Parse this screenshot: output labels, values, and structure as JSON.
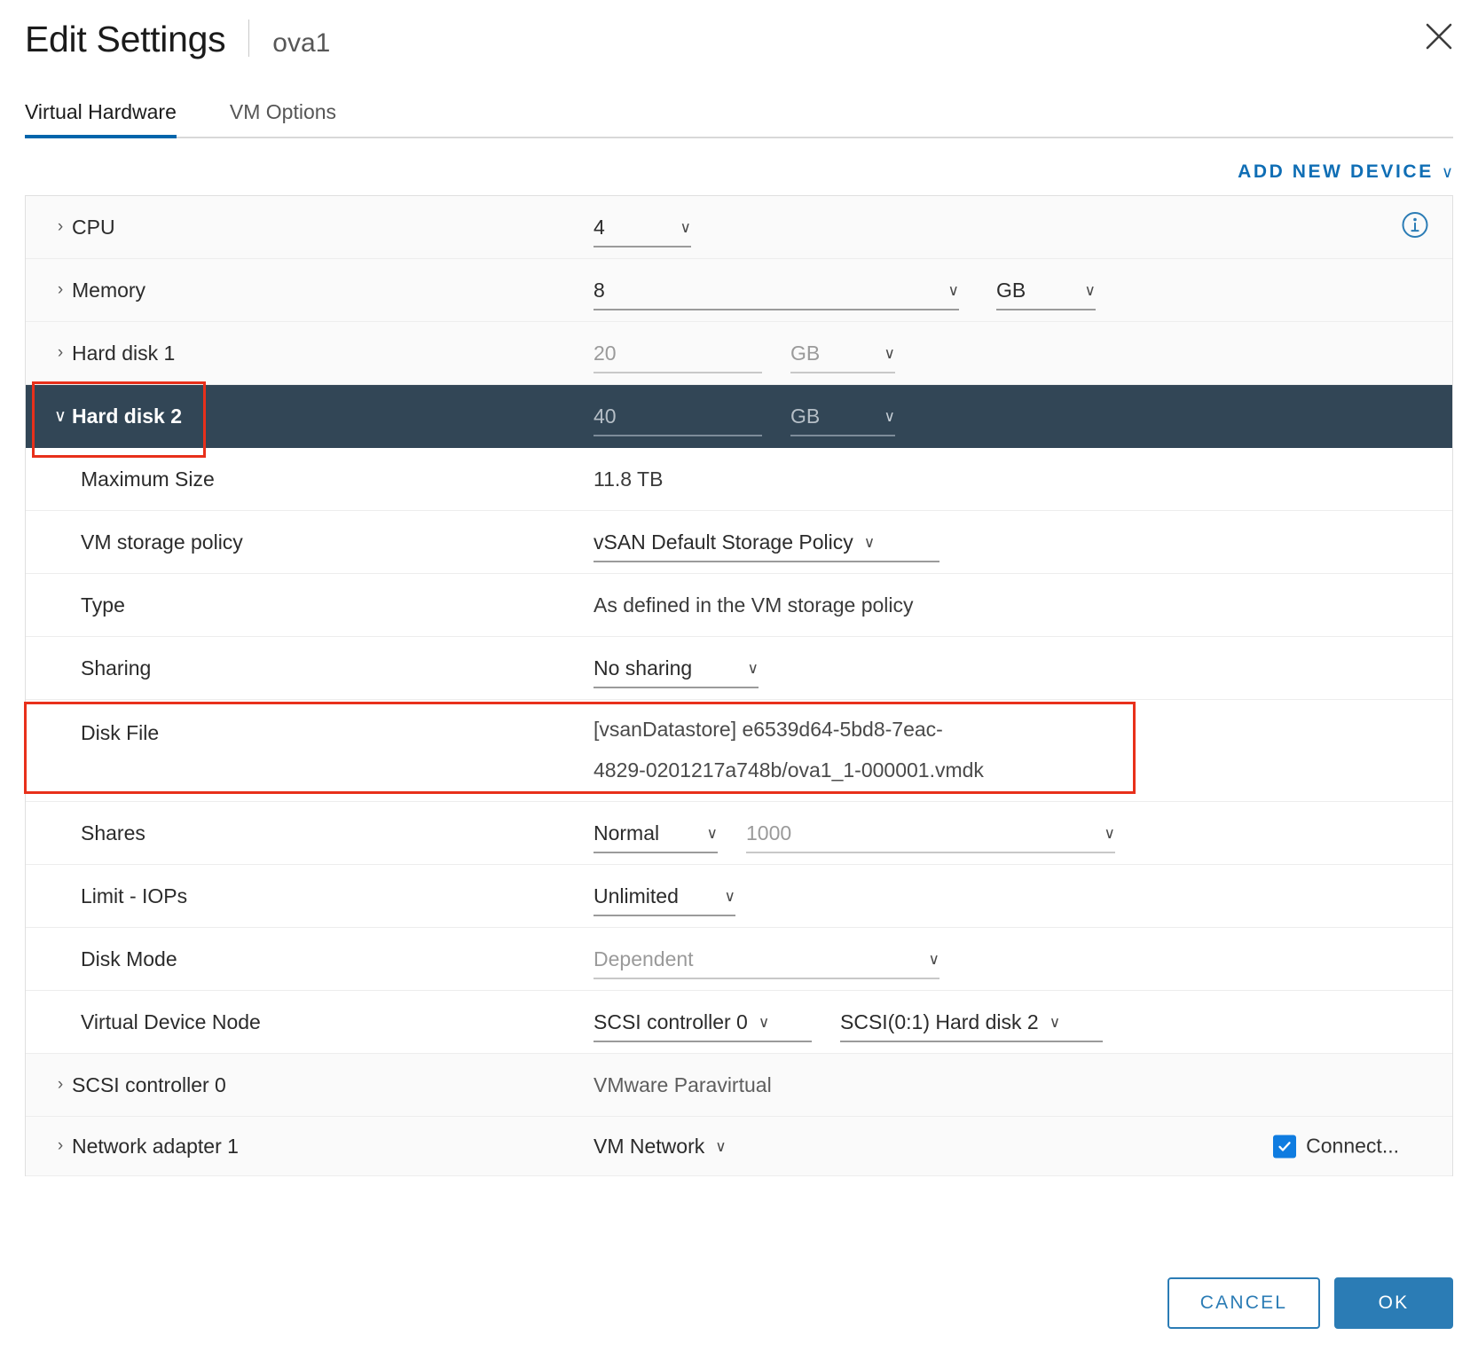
{
  "header": {
    "title": "Edit Settings",
    "vm_name": "ova1",
    "close_icon": "close-icon"
  },
  "tabs": [
    {
      "label": "Virtual Hardware",
      "active": true
    },
    {
      "label": "VM Options",
      "active": false
    }
  ],
  "toolbar": {
    "add_new_device": "ADD NEW DEVICE",
    "chevron": "∨"
  },
  "rows": {
    "cpu": {
      "label": "CPU",
      "caret": "›",
      "value": "4",
      "chevron": "∨",
      "info_icon": "info-icon"
    },
    "memory": {
      "label": "Memory",
      "caret": "›",
      "value": "8",
      "chevron": "∨",
      "unit": "GB",
      "unit_chevron": "∨"
    },
    "hard_disk_1": {
      "label": "Hard disk 1",
      "caret": "›",
      "value": "20",
      "unit": "GB",
      "unit_chevron": "∨"
    },
    "hard_disk_2": {
      "label": "Hard disk 2",
      "caret": "∨",
      "value": "40",
      "unit": "GB",
      "unit_chevron": "∨"
    },
    "maximum_size": {
      "label": "Maximum Size",
      "value": "11.8 TB"
    },
    "vm_storage_policy": {
      "label": "VM storage policy",
      "value": "vSAN Default Storage Policy",
      "chevron": "∨"
    },
    "type": {
      "label": "Type",
      "value": "As defined in the VM storage policy"
    },
    "sharing": {
      "label": "Sharing",
      "value": "No sharing",
      "chevron": "∨"
    },
    "disk_file": {
      "label": "Disk File",
      "value_line1": "[vsanDatastore] e6539d64-5bd8-7eac-",
      "value_line2": "4829-0201217a748b/ova1_1-000001.vmdk"
    },
    "shares": {
      "label": "Shares",
      "value": "Normal",
      "chevron": "∨",
      "amount": "1000",
      "amount_chevron": "∨"
    },
    "limit_iops": {
      "label": "Limit - IOPs",
      "value": "Unlimited",
      "chevron": "∨"
    },
    "disk_mode": {
      "label": "Disk Mode",
      "value": "Dependent",
      "chevron": "∨"
    },
    "virtual_device_node": {
      "label": "Virtual Device Node",
      "controller": "SCSI controller 0",
      "controller_chevron": "∨",
      "node": "SCSI(0:1) Hard disk 2",
      "node_chevron": "∨"
    },
    "scsi_controller_0": {
      "label": "SCSI controller 0",
      "caret": "›",
      "value": "VMware Paravirtual"
    },
    "network_adapter_1": {
      "label": "Network adapter 1",
      "caret": "›",
      "value": "VM Network",
      "chevron": "∨",
      "connect_label": "Connect...",
      "connect_checked": true,
      "check_icon": "check-icon"
    }
  },
  "footer": {
    "cancel": "CANCEL",
    "ok": "OK"
  },
  "colors": {
    "accent": "#0065ab",
    "link": "#0f6eb5",
    "selected_row": "#324656",
    "annotation": "#e8301b",
    "primary_button": "#2b7cb5",
    "checkbox": "#0f7ce0"
  }
}
